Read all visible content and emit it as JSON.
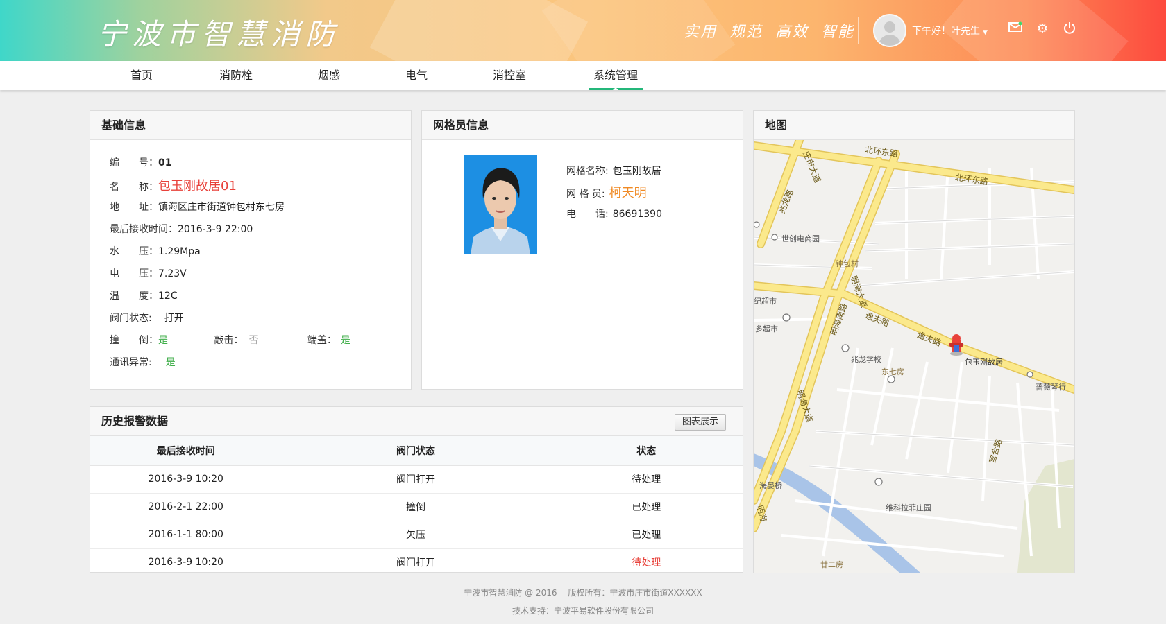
{
  "header": {
    "logo": "宁波市智慧消防",
    "slogans": [
      "实用",
      "规范",
      "高效",
      "智能"
    ],
    "greeting": "下午好！叶先生",
    "icons": [
      "mail-icon",
      "gear-icon",
      "power-icon"
    ]
  },
  "nav": {
    "items": [
      "首页",
      "消防栓",
      "烟感",
      "电气",
      "消控室",
      "系统管理"
    ],
    "active_index": 5
  },
  "basic_info": {
    "title": "基础信息",
    "number_label": "编　　号：",
    "number": "01",
    "name_label": "名　　称：",
    "name": "包玉刚故居01",
    "address_label": "地　　址：",
    "address": "镇海区庄市街道钟包村东七房",
    "last_time_label": "最后接收时间：",
    "last_time": "2016-3-9 22:00",
    "water_pressure_label": "水　　压：",
    "water_pressure": "1.29Mpa",
    "voltage_label": "电　　压：",
    "voltage": "7.23V",
    "temperature_label": "温　　度：",
    "temperature": "12C",
    "valve_label": "阀门状态:",
    "valve": "打开",
    "tilt_label": "撞　　倒：",
    "tilt": "是",
    "knock_label": "敲击：",
    "knock": "否",
    "cap_label": "端盖：",
    "cap": "是",
    "comm_label": "通讯异常:",
    "comm": "是"
  },
  "grid_info": {
    "title": "网格员信息",
    "grid_name_label": "网格名称:",
    "grid_name": "包玉刚故居",
    "member_label": "网 格 员:",
    "member": "柯天明",
    "phone_label": "电　　话:",
    "phone": "86691390"
  },
  "map": {
    "title": "地图",
    "road_labels": [
      "北环东路",
      "北环东路",
      "庄市大道",
      "兆龙路",
      "明海大道",
      "明海南路",
      "逸夫路",
      "逸夫路",
      "明海大道",
      "宫合路",
      "明海"
    ],
    "poi_labels": [
      "世创电商园",
      "钟包村",
      "纪超市",
      "多超市",
      "兆龙学校",
      "东七房",
      "包玉刚故居",
      "蔷薇琴行",
      "海晏桥",
      "维科拉菲庄园",
      "廿二房"
    ]
  },
  "history": {
    "title": "历史报警数据",
    "chart_button": "图表展示",
    "columns": [
      "最后接收时间",
      "阀门状态",
      "状态"
    ],
    "rows": [
      [
        "2016-3-9 10:20",
        "阀门打开",
        "待处理"
      ],
      [
        "2016-2-1 22:00",
        "撞倒",
        "已处理"
      ],
      [
        "2016-1-1 80:00",
        "欠压",
        "已处理"
      ],
      [
        "2016-3-9 10:20",
        "阀门打开",
        "待处理"
      ]
    ]
  },
  "footer": {
    "line1": "宁波市智慧消防 @ 2016　 版权所有：宁波市庄市街道XXXXXX",
    "line2": "技术支持：宁波平易软件股份有限公司"
  }
}
